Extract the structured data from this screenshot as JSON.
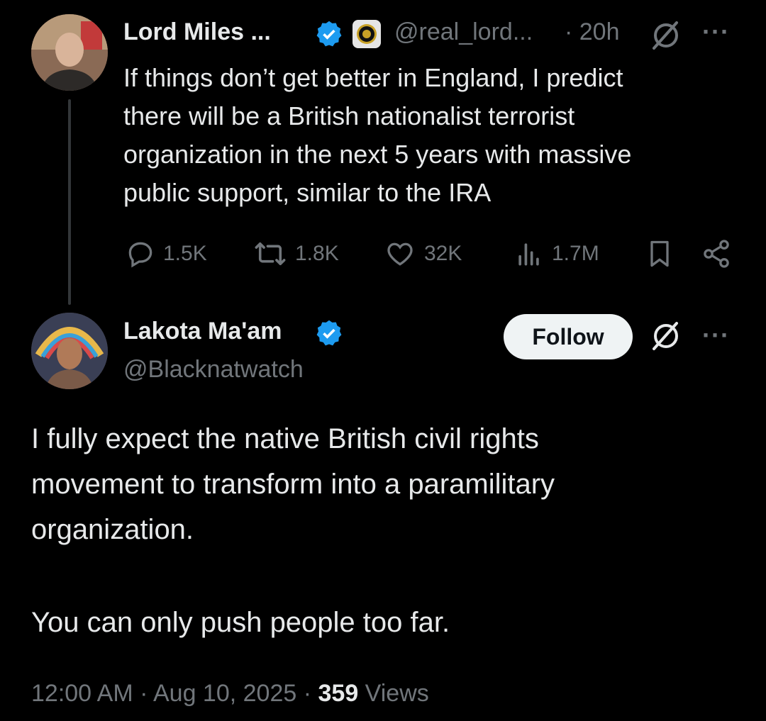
{
  "reply_tweet": {
    "author_name": "Lord Miles ...",
    "handle": "@real_lord...",
    "time": "· 20h",
    "text_lines": [
      "If things don’t get better in England, I predict",
      "there will be a British nationalist terrorist",
      "organization in the next 5 years with massive",
      "public support, similar to the IRA"
    ],
    "stats": {
      "replies": "1.5K",
      "reposts": "1.8K",
      "likes": "32K",
      "views": "1.7M"
    },
    "icons": [
      "verified-badge-icon",
      "affiliate-badge-icon",
      "grok-icon",
      "more-icon",
      "reply-icon",
      "repost-icon",
      "like-icon",
      "views-icon",
      "bookmark-icon",
      "share-icon"
    ]
  },
  "main_tweet": {
    "author_name": "Lakota Ma'am",
    "handle": "@Blacknatwatch",
    "follow_label": "Follow",
    "paragraph1_lines": [
      "I fully expect the native British civil rights",
      "movement to transform into a paramilitary",
      "organization."
    ],
    "paragraph2": "You can only push people too far.",
    "timestamp": "12:00 AM · Aug 10, 2025 · ",
    "views_count": "359",
    "views_label": " Views"
  },
  "colors": {
    "background": "#000000",
    "text": "#e7e9ea",
    "muted": "#71767b",
    "verified": "#1d9bf0",
    "button_bg": "#eff3f4"
  }
}
